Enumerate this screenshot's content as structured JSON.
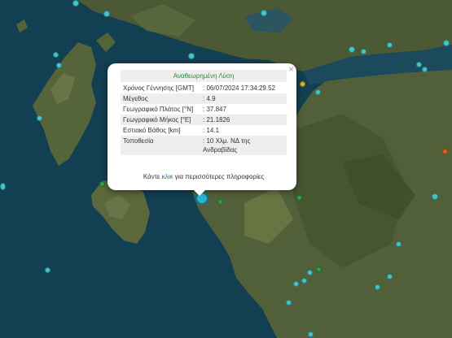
{
  "popup": {
    "title": "Αναθεωρημένη Λύση",
    "close_symbol": "×",
    "rows": [
      {
        "label": "Χρόνος Γέννησης [GMT]",
        "value": ": 06/07/2024 17:34:29.52"
      },
      {
        "label": "Μέγεθος",
        "value": ": 4.9"
      },
      {
        "label": "Γεωγραφικό Πλάτος [°N]",
        "value": ": 37.847"
      },
      {
        "label": "Γεωγραφικό Μήκος [°E]",
        "value": ": 21.1826"
      },
      {
        "label": "Εστιακό Βάθος [km]",
        "value": ": 14.1"
      },
      {
        "label": "Τοποθεσία",
        "value": ": 10 Χλμ. ΝΔ της Ανδραβίδας"
      }
    ],
    "more_prefix": "Κάντε ",
    "more_link": "κλικ",
    "more_suffix": " για περισσότερες πληροφορίες"
  },
  "map": {
    "marker_colors": {
      "cyan": "#3fc7cf",
      "green": "#2f9f49",
      "orange": "#d9621f",
      "yellow": "#d9b42a",
      "selected": "#29b6d6"
    }
  }
}
